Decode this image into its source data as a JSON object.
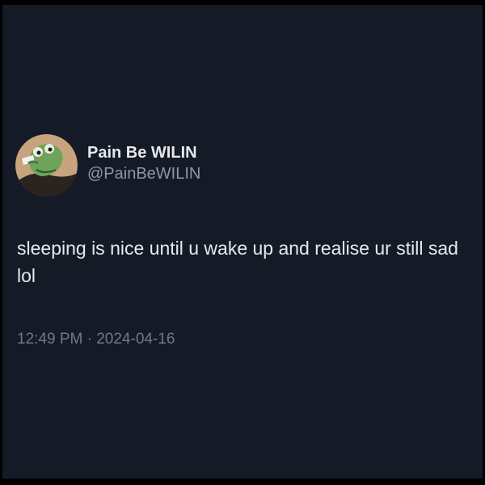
{
  "author": {
    "display_name": "Pain Be WILIN",
    "handle": "@PainBeWILIN",
    "avatar_icon": "frog-avatar-icon"
  },
  "tweet": {
    "text": "sleeping is nice until u wake up and realise ur still sad lol",
    "time": "12:49 PM",
    "separator": " · ",
    "date": "2024-04-16"
  },
  "colors": {
    "background": "#151b26",
    "primary_text": "#e7e9ea",
    "secondary_text": "#8b98a5"
  }
}
